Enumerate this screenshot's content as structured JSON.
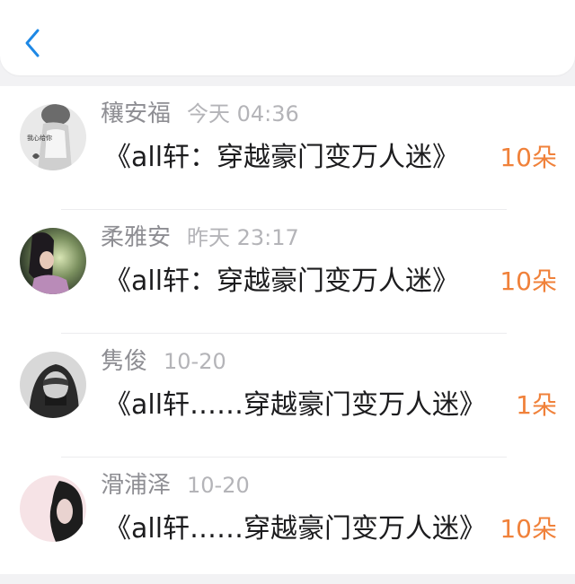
{
  "header": {
    "back_icon": "chevron-left-icon",
    "accent_color": "#1e88e5"
  },
  "entries": [
    {
      "name": "穰安福",
      "time": "今天 04:36",
      "title": "《all轩：穿越豪门变万人迷》",
      "count": "10朵",
      "avatar_text": "我心给你"
    },
    {
      "name": "柔雅安",
      "time": "昨天 23:17",
      "title": "《all轩：穿越豪门变万人迷》",
      "count": "10朵"
    },
    {
      "name": "隽俊",
      "time": "10-20",
      "title": "《all轩……穿越豪门变万人迷》",
      "count": "1朵"
    },
    {
      "name": "滑浦泽",
      "time": "10-20",
      "title": "《all轩……穿越豪门变万人迷》",
      "count": "10朵"
    }
  ],
  "colors": {
    "name": "#8e8e93",
    "time": "#b4b4b8",
    "title": "#1c1c1e",
    "count": "#f0813a"
  }
}
